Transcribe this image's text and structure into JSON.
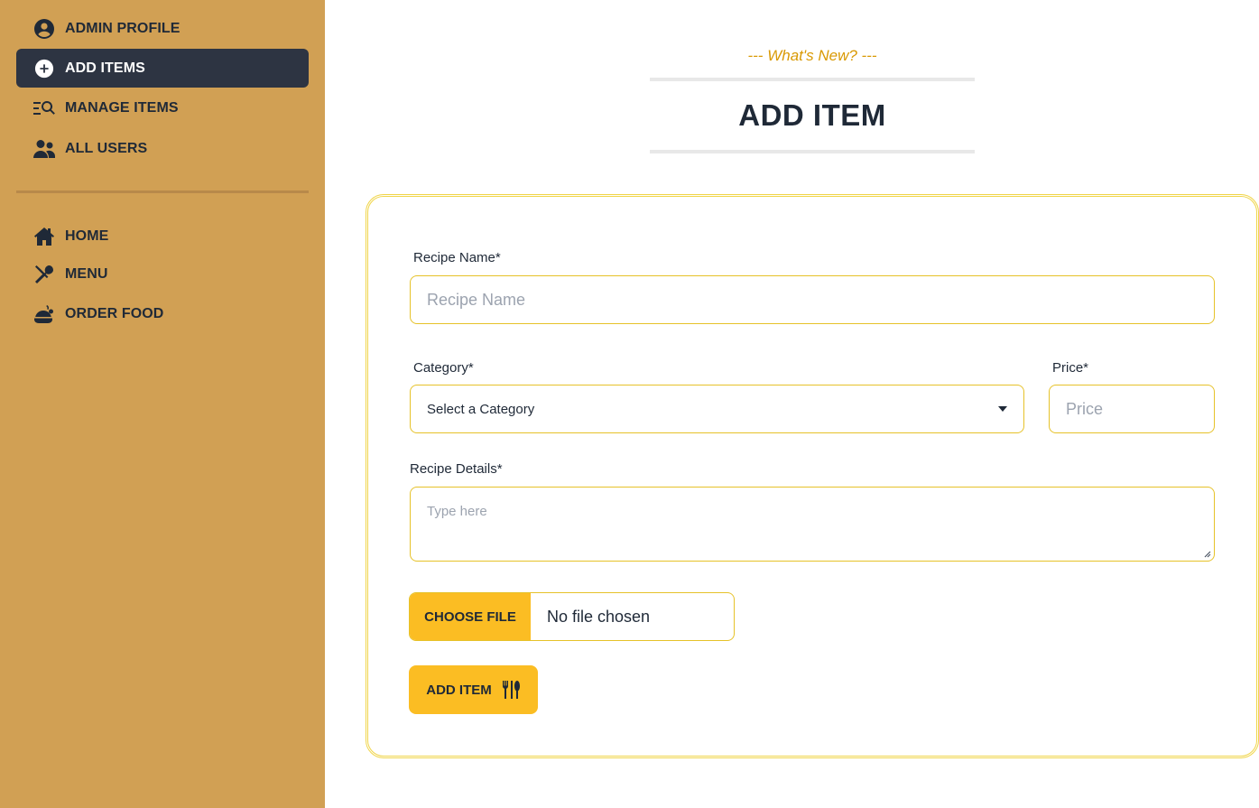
{
  "sidebar": {
    "items": [
      {
        "label": "ADMIN PROFILE",
        "icon": "user-circle-icon"
      },
      {
        "label": "ADD ITEMS",
        "icon": "plus-circle-icon",
        "active": true
      },
      {
        "label": "MANAGE ITEMS",
        "icon": "list-search-icon"
      },
      {
        "label": "ALL USERS",
        "icon": "users-icon"
      }
    ],
    "links": [
      {
        "label": "HOME",
        "icon": "home-icon"
      },
      {
        "label": "MENU",
        "icon": "utensils-cross-icon"
      },
      {
        "label": "ORDER FOOD",
        "icon": "bowl-food-icon"
      }
    ]
  },
  "header": {
    "subtitle": "--- What's New? ---",
    "title": "ADD ITEM"
  },
  "form": {
    "recipe_name": {
      "label": "Recipe Name*",
      "placeholder": "Recipe Name",
      "value": ""
    },
    "category": {
      "label": "Category*",
      "selected": "Select a Category"
    },
    "price": {
      "label": "Price*",
      "placeholder": "Price",
      "value": ""
    },
    "details": {
      "label": "Recipe Details*",
      "placeholder": "Type here",
      "value": ""
    },
    "file": {
      "button_label": "Choose File",
      "status": "No file chosen"
    },
    "submit": {
      "label": "Add Item",
      "icon": "utensils-icon"
    }
  },
  "colors": {
    "sidebar_bg": "#d1a054",
    "active_bg": "#2d3442",
    "accent": "#fbbd23",
    "subtitle": "#d99904",
    "border": "#e6c229"
  }
}
